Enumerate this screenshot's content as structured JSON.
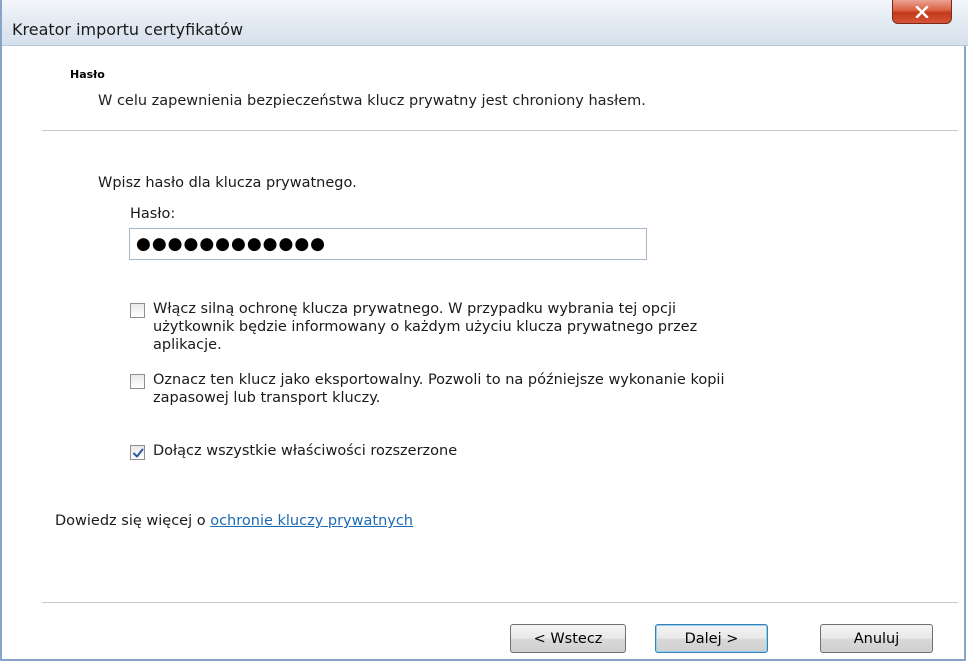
{
  "window": {
    "title": "Kreator importu certyfikatów",
    "close_icon": "close-icon"
  },
  "header": {
    "section_title": "Hasło",
    "section_description": "W celu zapewnienia bezpieczeństwa klucz prywatny jest chroniony hasłem."
  },
  "password": {
    "prompt": "Wpisz hasło dla klucza prywatnego.",
    "label": "Hasło:",
    "value": "●●●●●●●●●●●●"
  },
  "options": [
    {
      "label_line1": "Włącz silną ochronę klucza prywatnego. W przypadku wybrania tej opcji",
      "label_line2": "użytkownik będzie informowany o każdym użyciu klucza prywatnego przez",
      "label_line3": "aplikacje.",
      "checked": false
    },
    {
      "label_line1": "Oznacz ten klucz jako eksportowalny. Pozwoli to na późniejsze wykonanie kopii",
      "label_line2": "zapasowej lub transport kluczy.",
      "checked": false
    },
    {
      "label_line1": "Dołącz wszystkie właściwości rozszerzone",
      "checked": true
    }
  ],
  "learn_more": {
    "prefix": "Dowiedz się więcej o ",
    "link_text": "ochronie kluczy prywatnych"
  },
  "buttons": {
    "back": "< Wstecz",
    "next": "Dalej >",
    "cancel": "Anuluj"
  },
  "colors": {
    "link": "#1d6ab5",
    "close_button": "#c8432a",
    "frame": "#86a4c4"
  }
}
